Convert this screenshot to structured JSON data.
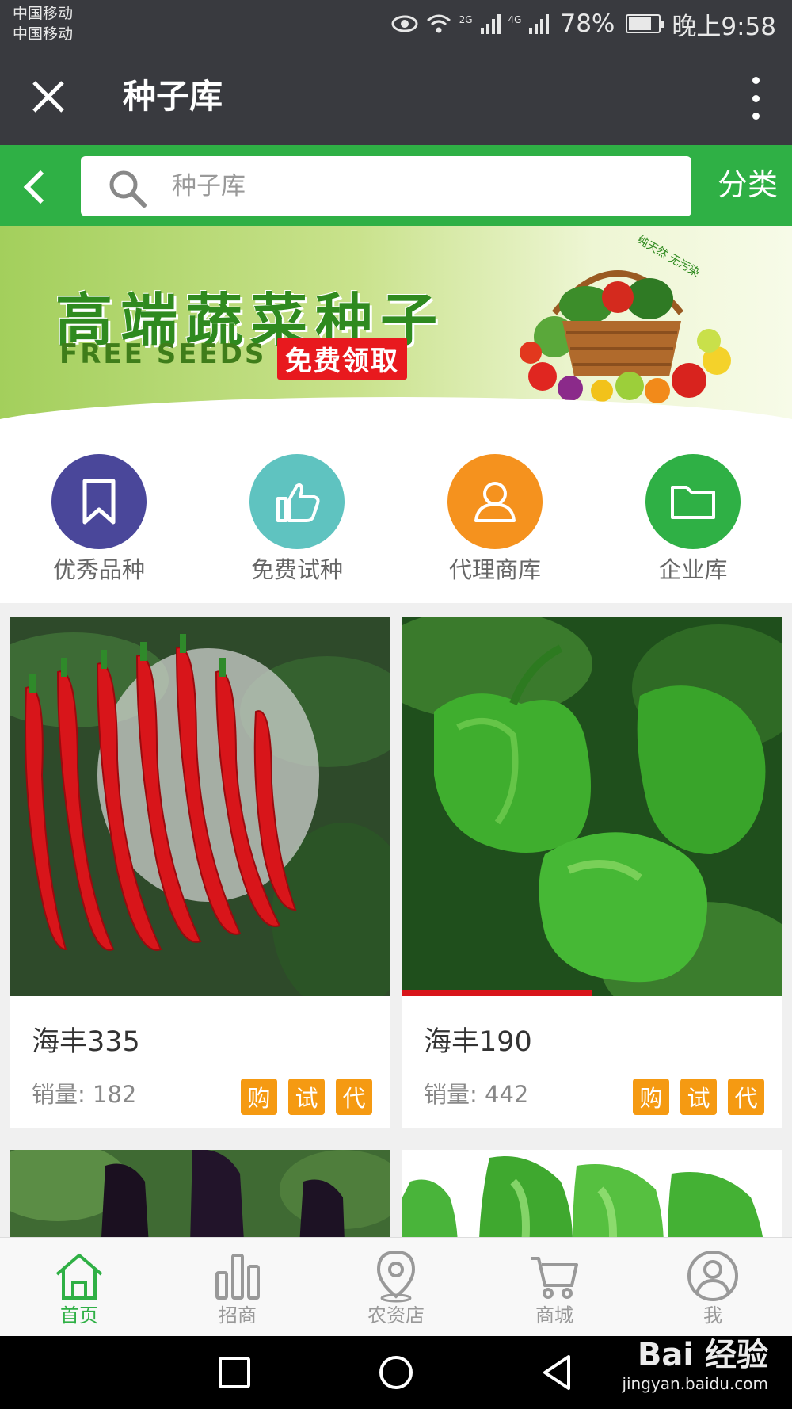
{
  "status_bar": {
    "carrier1": "中国移动",
    "carrier2": "中国移动",
    "net1": "2G",
    "net2": "4G",
    "battery": "78%",
    "battery_level": 0.78,
    "time": "晚上9:58"
  },
  "titlebar": {
    "title": "种子库",
    "close_icon": "close-icon",
    "more_icon": "more-vertical-icon"
  },
  "search": {
    "placeholder": "种子库",
    "category_label": "分类"
  },
  "banner": {
    "title": "高端蔬菜种子",
    "subtitle": "FREE SEEDS",
    "badge": "免费领取",
    "tag": "纯天然 无污染"
  },
  "quick_nav": [
    {
      "label": "优秀品种",
      "icon": "bookmark-icon",
      "color": "#4a479a"
    },
    {
      "label": "免费试种",
      "icon": "thumbs-up-icon",
      "color": "#5fc3c0"
    },
    {
      "label": "代理商库",
      "icon": "user-icon",
      "color": "#f5921e"
    },
    {
      "label": "企业库",
      "icon": "folder-icon",
      "color": "#2fb045"
    }
  ],
  "products": [
    {
      "name": "海丰335",
      "sales": "销量: 182",
      "tags": [
        "购",
        "试",
        "代"
      ],
      "image": "red chili peppers"
    },
    {
      "name": "海丰190",
      "sales": "销量: 442",
      "tags": [
        "购",
        "试",
        "代"
      ],
      "image": "green bell peppers"
    },
    {
      "name": "",
      "sales": "",
      "tags": [],
      "image": "eggplants"
    },
    {
      "name": "",
      "sales": "",
      "tags": [],
      "image": "green peppers"
    }
  ],
  "tabbar": {
    "items": [
      {
        "label": "首页",
        "icon": "home-icon",
        "active": true
      },
      {
        "label": "招商",
        "icon": "bar-chart-icon",
        "active": false
      },
      {
        "label": "农资店",
        "icon": "location-pin-icon",
        "active": false
      },
      {
        "label": "商城",
        "icon": "cart-icon",
        "active": false
      },
      {
        "label": "我",
        "icon": "user-icon",
        "active": false
      }
    ]
  },
  "watermark": {
    "logo": "Bai  经验",
    "url": "jingyan.baidu.com"
  },
  "colors": {
    "green": "#2fb045",
    "dark": "#393a3f",
    "orange": "#f59a12"
  }
}
